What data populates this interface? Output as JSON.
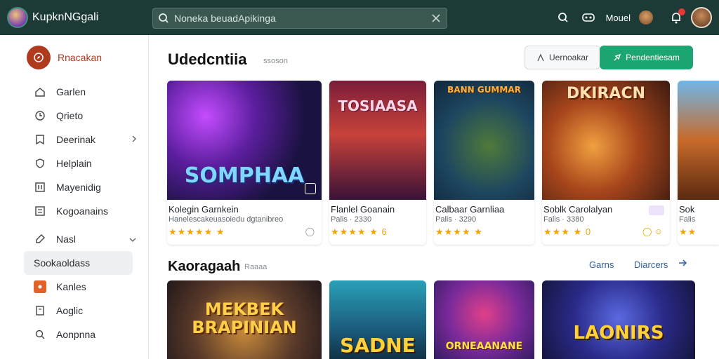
{
  "app": {
    "name": "KupknNGgali"
  },
  "search": {
    "placeholder": "Noneka beuadApikinga"
  },
  "topbar": {
    "label": "Mouel"
  },
  "sidebar": {
    "header": "Rnacakan",
    "items": [
      {
        "label": "Garlen",
        "icon": "home-icon"
      },
      {
        "label": "Qrieto",
        "icon": "clock-icon"
      },
      {
        "label": "Deerinak",
        "icon": "download-icon",
        "chevron": true
      },
      {
        "label": "Helplain",
        "icon": "shield-icon"
      },
      {
        "label": "Mayenidig",
        "icon": "grid-icon"
      },
      {
        "label": "Kogoanains",
        "icon": "list-icon"
      },
      {
        "label": "Nasl",
        "icon": "tag-icon",
        "chevron": true
      },
      {
        "label": "Sookaoldass",
        "icon": "",
        "active": true
      },
      {
        "label": "Kanles",
        "icon": "app-icon"
      },
      {
        "label": "Aoglic",
        "icon": "doc-icon"
      },
      {
        "label": "Aonpnna",
        "icon": "search-icon"
      }
    ]
  },
  "section1": {
    "title": "Udedcntiia",
    "subtitle": "ssoson",
    "outline_button": "Uernoakar",
    "primary_button": "Pendentiesam",
    "cards": [
      {
        "art_title": "SOMPHAA",
        "title": "Kolegin Garnkein",
        "subtitle": "Hanelescakeuasoiedu dgtanibreo",
        "stars": "★★★★★ ★",
        "extra": "◯"
      },
      {
        "art_title": "TOSIAASA",
        "title": "Flanlel Goanain",
        "subtitle": "Palis · 2330",
        "stars": "★★★★ ★ 6",
        "extra": ""
      },
      {
        "art_title": "BANN GUMMAR",
        "title": "Calbaar Garnliaa",
        "subtitle": "Palis · 3290",
        "stars": "★★★★ ★",
        "extra": ""
      },
      {
        "art_title": "DKIRACN",
        "title": "Soblk Carolalyan",
        "subtitle": "Falis · 3380",
        "stars": "★★★ ★ 0",
        "extra": "◯ ☺"
      },
      {
        "art_title": "",
        "title": "Sok",
        "subtitle": "Falis",
        "stars": "★★",
        "extra": ""
      }
    ]
  },
  "section2": {
    "title": "Kaoragaah",
    "subtitle": "Raaaa",
    "link1": "Garns",
    "link2": "Diarcers",
    "cards": [
      {
        "art_title": "MEKBEK BRAPINIAN"
      },
      {
        "art_title": "SADNE"
      },
      {
        "art_title": "ORNEAANANE"
      },
      {
        "art_title": "LAONIRS"
      }
    ]
  },
  "colors": {
    "topbar": "#1d3b36",
    "accent_green": "#1ea672",
    "accent_orange": "#b03a1e",
    "star": "#f2a500"
  }
}
